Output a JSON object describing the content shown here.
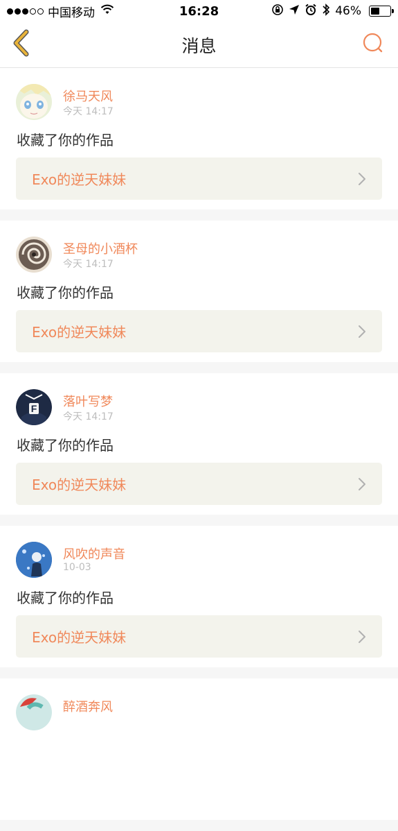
{
  "status_bar": {
    "carrier": "中国移动",
    "time": "16:28",
    "battery": "46%",
    "battery_level": 0.46,
    "signal": "●●●○○"
  },
  "nav": {
    "title": "消息",
    "back_icon": "chevron-left-icon",
    "search_icon": "search-icon"
  },
  "colors": {
    "accent": "#f0885a",
    "back_arrow": "#e8b33a",
    "card_link_bg": "#f3f3ec",
    "page_bg": "#f6f6f6"
  },
  "messages": [
    {
      "name": "徐马天风",
      "time": "今天 14:17",
      "text": "收藏了你的作品",
      "work": "Exo的逆天妹妹"
    },
    {
      "name": "圣母的小酒杯",
      "time": "今天 14:17",
      "text": "收藏了你的作品",
      "work": "Exo的逆天妹妹"
    },
    {
      "name": "落叶写梦",
      "time": "今天 14:17",
      "text": "收藏了你的作品",
      "work": "Exo的逆天妹妹"
    },
    {
      "name": "风吹的声音",
      "time": "10-03",
      "text": "收藏了你的作品",
      "work": "Exo的逆天妹妹"
    },
    {
      "name": "醉酒奔风",
      "time": "",
      "text": "",
      "work": ""
    }
  ]
}
